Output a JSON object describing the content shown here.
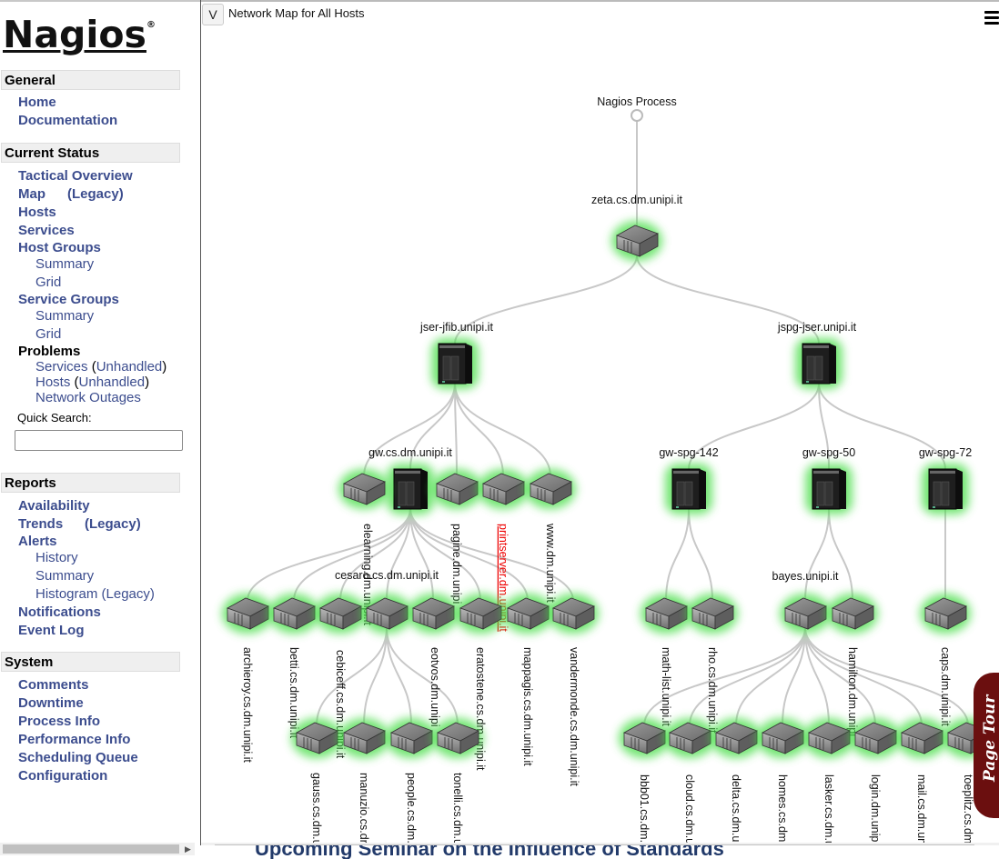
{
  "logo": {
    "text": "Nagios",
    "mark": "®"
  },
  "sidebar": {
    "general": {
      "title": "General",
      "items": [
        "Home",
        "Documentation"
      ]
    },
    "current_status": {
      "title": "Current Status",
      "tactical": "Tactical Overview",
      "map": "Map",
      "map_legacy": "(Legacy)",
      "hosts": "Hosts",
      "services": "Services",
      "host_groups": "Host Groups",
      "hg_summary": "Summary",
      "hg_grid": "Grid",
      "service_groups": "Service Groups",
      "sg_summary": "Summary",
      "sg_grid": "Grid",
      "problems": "Problems",
      "p_services": "Services",
      "p_services_unhandled": "Unhandled",
      "p_hosts": "Hosts",
      "p_hosts_unhandled": "Unhandled",
      "p_outages": "Network Outages",
      "quick_search_label": "Quick Search:",
      "quick_search_value": ""
    },
    "reports": {
      "title": "Reports",
      "availability": "Availability",
      "trends": "Trends",
      "trends_legacy": "(Legacy)",
      "alerts": "Alerts",
      "history": "History",
      "summary": "Summary",
      "histogram": "Histogram (Legacy)",
      "notifications": "Notifications",
      "event_log": "Event Log"
    },
    "system": {
      "title": "System",
      "items": [
        "Comments",
        "Downtime",
        "Process Info",
        "Performance Info",
        "Scheduling Queue",
        "Configuration"
      ]
    }
  },
  "main": {
    "toggle_label": "V",
    "title": "Network Map for All Hosts",
    "page_tour": "Page Tour",
    "bottom_text": "Upcoming Seminar on the Influence of Standards"
  },
  "colors": {
    "link": "#3c4d8e",
    "up_glow": "#44dd44",
    "problem": "#ee0000",
    "edge": "#c8c8c8"
  },
  "map": {
    "root": "Nagios Process",
    "nodes": [
      {
        "id": "zeta",
        "label": "zeta.cs.dm.unipi.it",
        "type": "rack",
        "parent": "root"
      },
      {
        "id": "jser",
        "label": "jser-jfib.unipi.it",
        "type": "tower",
        "parent": "zeta"
      },
      {
        "id": "jspg",
        "label": "jspg-jser.unipi.it",
        "type": "tower",
        "parent": "zeta"
      },
      {
        "id": "gw",
        "label": "gw.cs.dm.unipi.it",
        "type": "tower",
        "parent": "jser"
      },
      {
        "id": "elearning",
        "label": "elearning.dm.unipi.it",
        "type": "rack",
        "parent": "jser"
      },
      {
        "id": "pagine",
        "label": "pagine.dm.unipi",
        "type": "rack",
        "parent": "jser"
      },
      {
        "id": "printserver",
        "label": "printserver.dm.unipi.it",
        "type": "rack",
        "parent": "jser",
        "status": "problem"
      },
      {
        "id": "www",
        "label": "www.dm.unipi.it",
        "type": "rack",
        "parent": "jser"
      },
      {
        "id": "gw142",
        "label": "gw-spg-142",
        "type": "tower",
        "parent": "jspg"
      },
      {
        "id": "gw50",
        "label": "gw-spg-50",
        "type": "tower",
        "parent": "jspg"
      },
      {
        "id": "gw72",
        "label": "gw-spg-72",
        "type": "tower",
        "parent": "jspg"
      },
      {
        "id": "archieroy",
        "label": "archieroy.cs.dm.unipi.it",
        "type": "rack",
        "parent": "gw"
      },
      {
        "id": "betti",
        "label": "betti.cs.dm.unipi.it",
        "type": "rack",
        "parent": "gw"
      },
      {
        "id": "cebiceff",
        "label": "cebiceff.cs.dm.unipi.it",
        "type": "rack",
        "parent": "gw"
      },
      {
        "id": "cesaro",
        "label": "cesaro.cs.dm.unipi.it",
        "type": "rack",
        "parent": "gw"
      },
      {
        "id": "eotvos",
        "label": "eotvos.dm.unipi",
        "type": "rack",
        "parent": "gw"
      },
      {
        "id": "eratostene",
        "label": "eratostene.cs.dm.unipi.it",
        "type": "rack",
        "parent": "gw"
      },
      {
        "id": "mappagis",
        "label": "mappagis.cs.dm.unipi.it",
        "type": "rack",
        "parent": "gw"
      },
      {
        "id": "vandermonde",
        "label": "vandermonde.cs.dm.unipi.it",
        "type": "rack",
        "parent": "gw"
      },
      {
        "id": "gauss",
        "label": "gauss.cs.dm.u",
        "type": "rack",
        "parent": "cesaro"
      },
      {
        "id": "manuzio",
        "label": "manuzio.cs.dr",
        "type": "rack",
        "parent": "cesaro"
      },
      {
        "id": "people",
        "label": "people.cs.dm.",
        "type": "rack",
        "parent": "cesaro"
      },
      {
        "id": "tonelli",
        "label": "tonelli.cs.dm.u",
        "type": "rack",
        "parent": "cesaro"
      },
      {
        "id": "mathlist",
        "label": "math-list.unipi.it",
        "type": "rack",
        "parent": "gw142"
      },
      {
        "id": "rho",
        "label": "rho.cs.dm.unipi.it",
        "type": "rack",
        "parent": "gw142"
      },
      {
        "id": "bayes",
        "label": "bayes.unipi.it",
        "type": "rack",
        "parent": "gw50"
      },
      {
        "id": "hamilton",
        "label": "hamilton.dm.unipi",
        "type": "rack",
        "parent": "gw50"
      },
      {
        "id": "caps",
        "label": "caps.dm.unipi.it",
        "type": "rack",
        "parent": "gw72"
      },
      {
        "id": "bbb01",
        "label": "bbb01.cs.dm.",
        "type": "rack",
        "parent": "bayes"
      },
      {
        "id": "cloud",
        "label": "cloud.cs.dm.u",
        "type": "rack",
        "parent": "bayes"
      },
      {
        "id": "delta",
        "label": "delta.cs.dm.u",
        "type": "rack",
        "parent": "bayes"
      },
      {
        "id": "homes",
        "label": "homes.cs.dm.",
        "type": "rack",
        "parent": "bayes"
      },
      {
        "id": "lasker",
        "label": "lasker.cs.dm.u",
        "type": "rack",
        "parent": "bayes"
      },
      {
        "id": "login",
        "label": "login.dm.unipi",
        "type": "rack",
        "parent": "bayes"
      },
      {
        "id": "mail",
        "label": "mail.cs.dm.un",
        "type": "rack",
        "parent": "bayes"
      },
      {
        "id": "toeplitz",
        "label": "toeplitz.cs.dm",
        "type": "rack",
        "parent": "bayes"
      }
    ]
  }
}
